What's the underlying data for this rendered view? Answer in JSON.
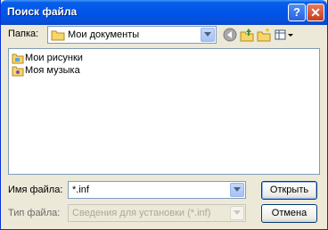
{
  "window": {
    "title": "Поиск файла",
    "help_glyph": "?",
    "close_glyph": "✕"
  },
  "toolbar": {
    "folder_label": "Папка:",
    "folder_value": "Мои документы",
    "icons": [
      "folder-icon",
      "back-icon",
      "up-folder-icon",
      "new-folder-icon",
      "view-menu-icon"
    ]
  },
  "files": [
    {
      "name": "Мои рисунки",
      "icon": "special-folder-icon"
    },
    {
      "name": "Моя музыка",
      "icon": "special-folder-icon"
    }
  ],
  "form": {
    "filename_label": "Имя файла:",
    "filename_value": "*.inf",
    "filetype_label": "Тип файла:",
    "filetype_value": "Сведения для установки (*.inf)",
    "open_button": "Открыть",
    "cancel_button": "Отмена"
  },
  "colors": {
    "title_bar": "#0055ea",
    "dialog_bg": "#ece9d8",
    "border": "#7f9db9"
  }
}
